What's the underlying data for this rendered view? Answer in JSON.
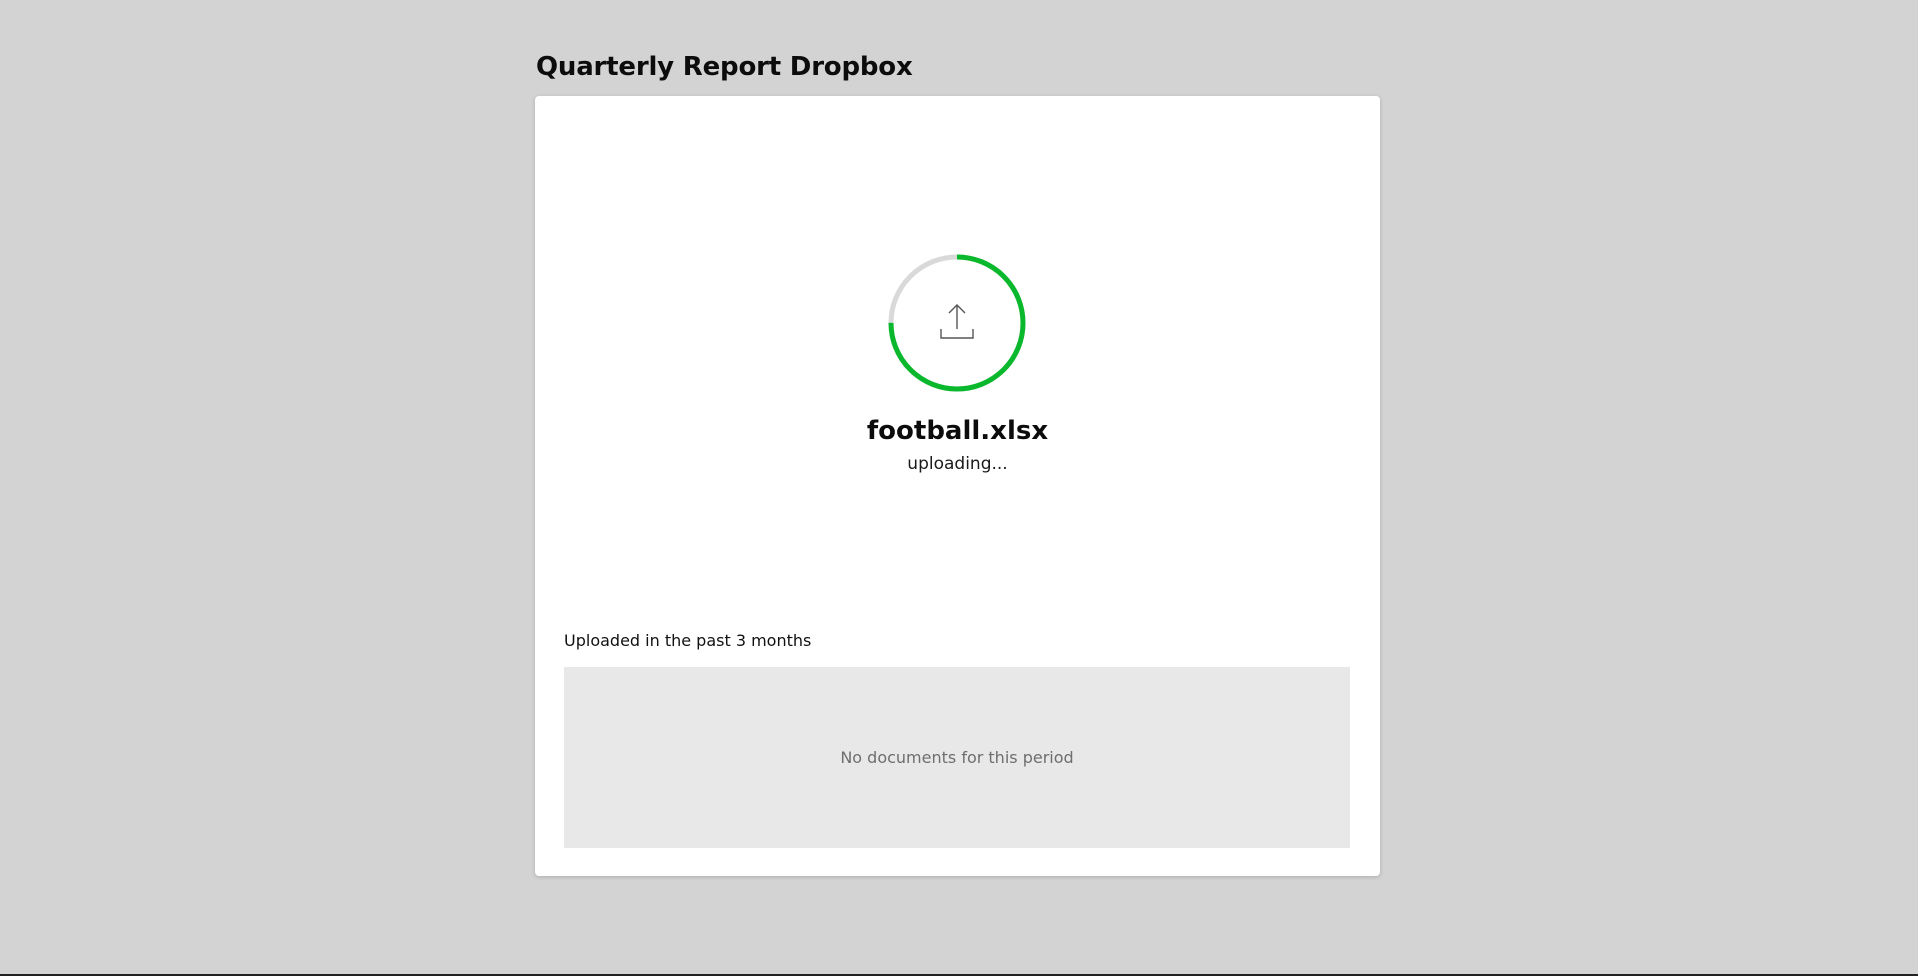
{
  "header": {
    "title": "Quarterly Report Dropbox"
  },
  "upload": {
    "file_name": "football.xlsx",
    "status": "uploading...",
    "progress": 0.75,
    "icon": "upload-icon",
    "progress_color": "#09b82c",
    "track_color": "#d9d9d9"
  },
  "history": {
    "label": "Uploaded in the past 3 months",
    "empty_message": "No documents for this period"
  }
}
